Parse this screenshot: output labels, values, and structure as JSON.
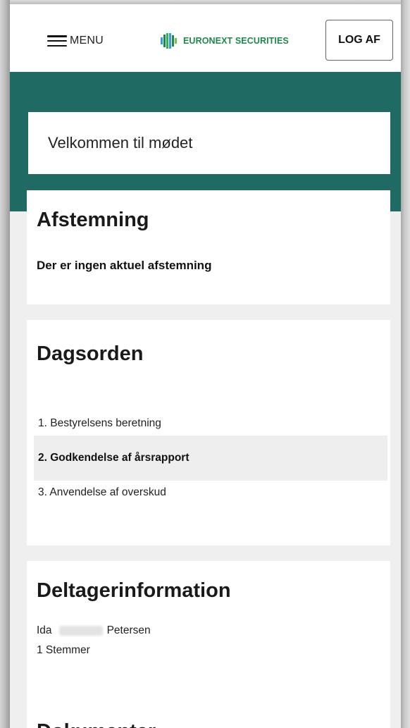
{
  "header": {
    "menu_label": "MENU",
    "logo_text": "EURONEXT SECURITIES",
    "logout_label": "LOG AF",
    "brand_color": "#1f6b63"
  },
  "welcome": {
    "text": "Velkommen til mødet"
  },
  "voting": {
    "title": "Afstemning",
    "message": "Der er ingen aktuel afstemning"
  },
  "agenda": {
    "title": "Dagsorden",
    "items": [
      {
        "label": "1. Bestyrelsens beretning",
        "active": false
      },
      {
        "label": "2. Godkendelse af årsrapport",
        "active": true
      },
      {
        "label": "3. Anvendelse af overskud",
        "active": false
      }
    ]
  },
  "participant": {
    "title": "Deltagerinformation",
    "first_name": "Ida",
    "last_name": "Petersen",
    "votes": "1 Stemmer"
  },
  "documents": {
    "title": "Dokumenter"
  }
}
